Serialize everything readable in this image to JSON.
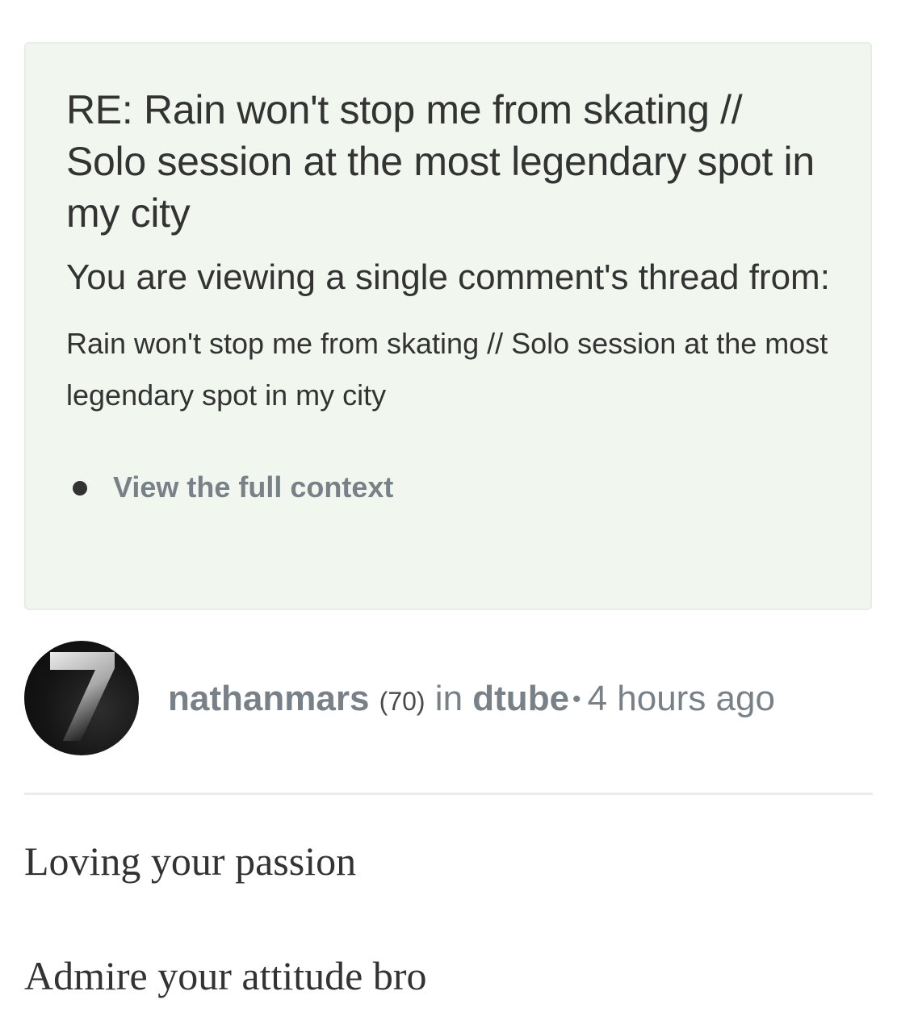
{
  "context": {
    "title": "RE: Rain won't stop me from skating // Solo session at the most legendary spot in my city",
    "viewing_note": "You are viewing a single comment's thread from:",
    "parent_title": "Rain won't stop me from skating // Solo session at the most legendary spot in my city",
    "links": [
      {
        "label": "View the full context"
      }
    ]
  },
  "author": {
    "avatar_glyph": "7",
    "name": "nathanmars",
    "reputation": "(70)",
    "in_label": "in",
    "community": "dtube",
    "separator": "•",
    "time_ago": "4 hours ago"
  },
  "comment": {
    "paragraphs": [
      "Loving your passion",
      "Admire your attitude bro"
    ]
  },
  "colors": {
    "context_bg": "#f1f7ef",
    "link_gray": "#788187",
    "text": "#333333"
  }
}
